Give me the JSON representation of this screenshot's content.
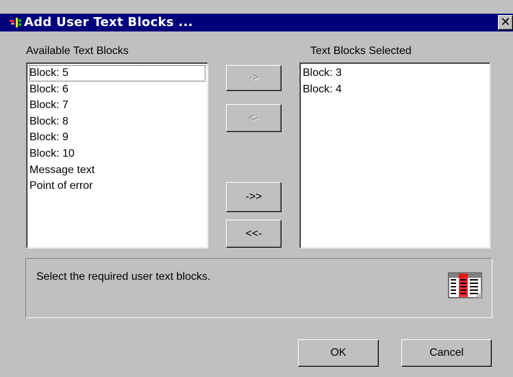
{
  "window": {
    "title": "Add User Text Blocks ...",
    "close_symbol": "✕",
    "icon": "dialog-app-icon"
  },
  "available": {
    "label": "Available Text Blocks",
    "items": [
      "Block:  5",
      "Block:  6",
      "Block:  7",
      "Block:  8",
      "Block:  9",
      "Block: 10",
      "Message text",
      "Point of error"
    ]
  },
  "selected": {
    "label": "Text Blocks Selected",
    "items": [
      "Block:  3",
      "Block:  4"
    ]
  },
  "buttons": {
    "add": "->",
    "remove": "<-",
    "add_all": "->>",
    "remove_all": "<<-",
    "ok": "OK",
    "cancel": "Cancel"
  },
  "hint": {
    "text": "Select the required user text blocks.",
    "icon": "text-blocks-list-icon"
  },
  "colors": {
    "titlebar": "#00007b",
    "face": "#c0c0c0",
    "list_bg": "#ffffff",
    "icon_red": "#ff0000"
  }
}
